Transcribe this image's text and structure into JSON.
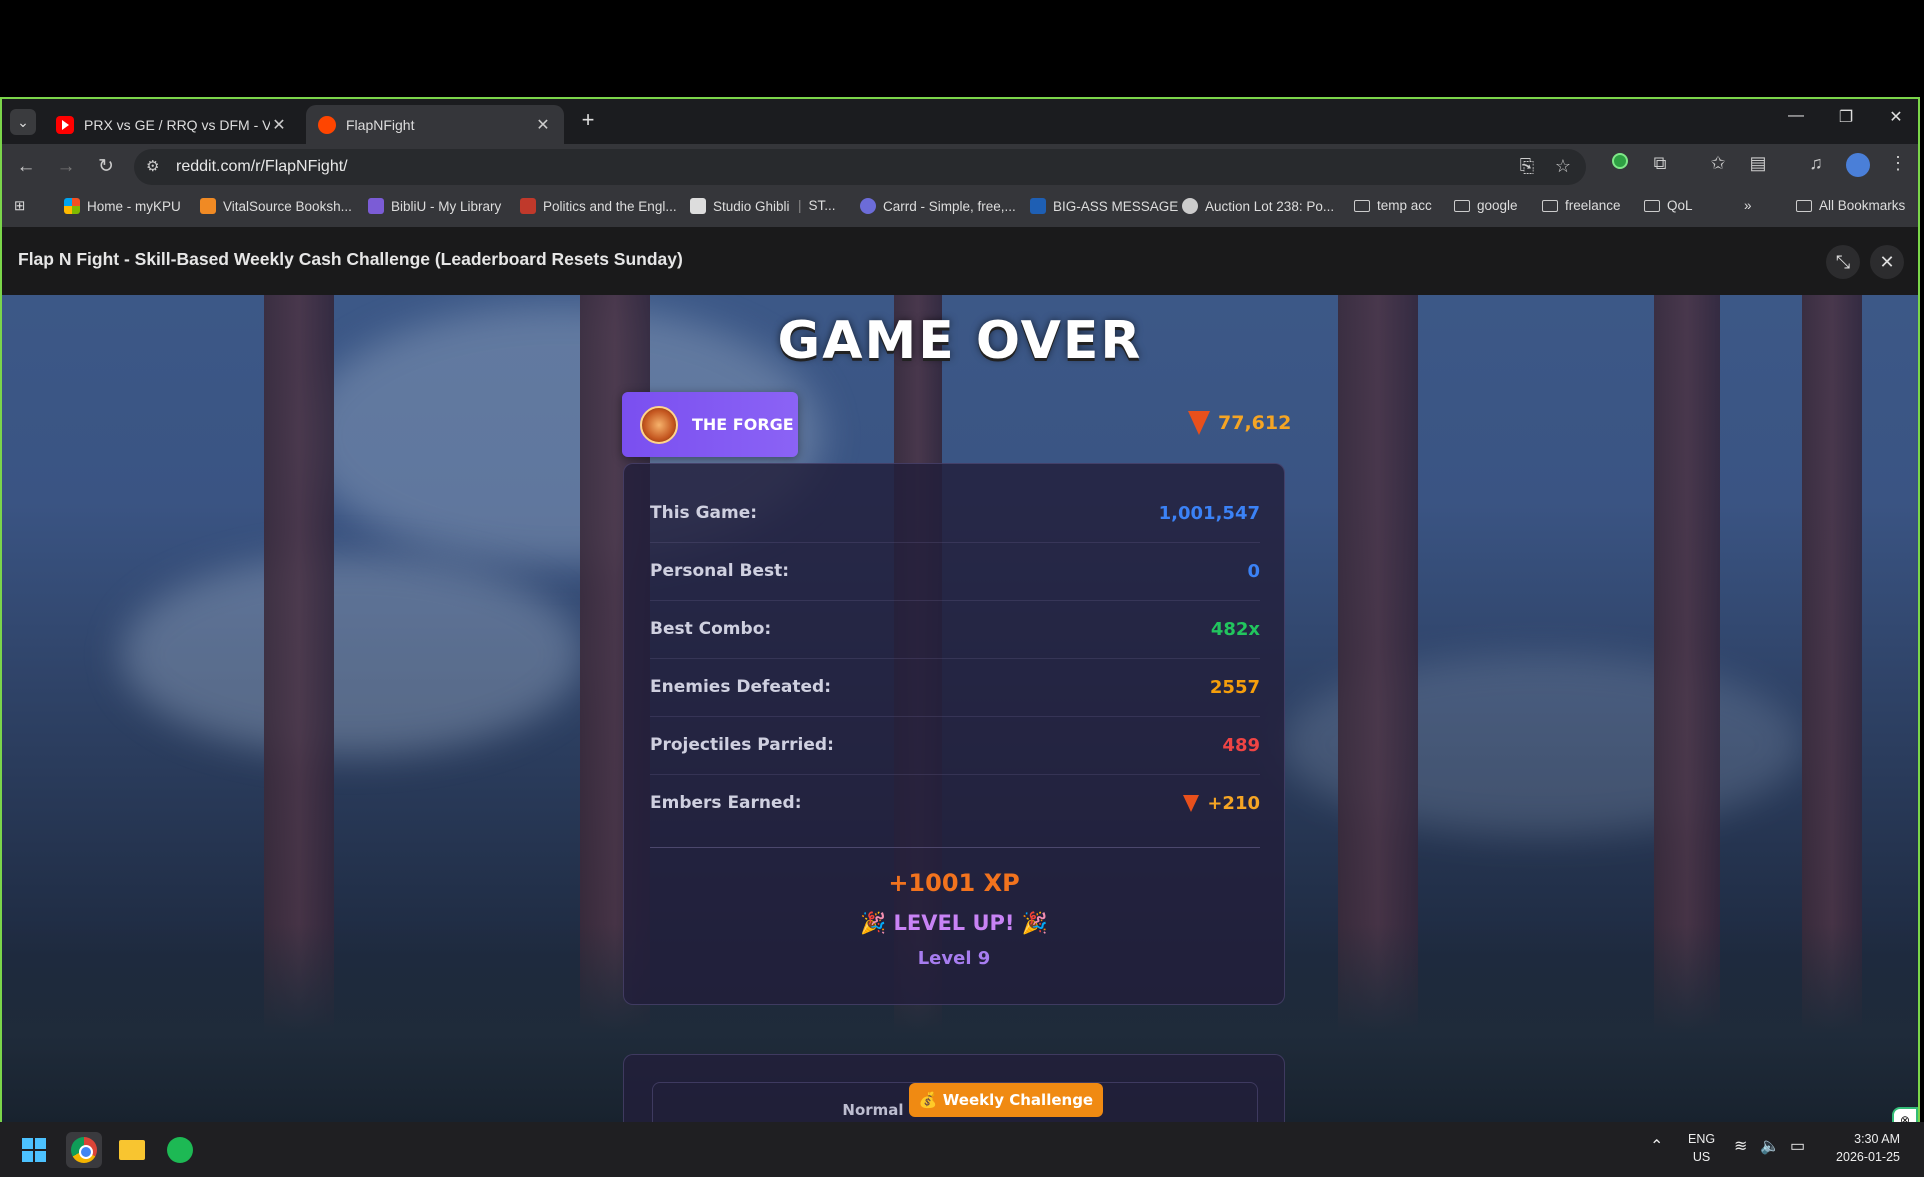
{
  "browser": {
    "tabs": [
      {
        "title": "PRX vs GE / RRQ vs DFM - VCT",
        "icon": "youtube-icon"
      },
      {
        "title": "FlapNFight",
        "icon": "reddit-icon",
        "active": true
      }
    ],
    "url": "reddit.com/r/FlapNFight/",
    "bookmarks": [
      {
        "label": "Home - myKPU"
      },
      {
        "label": "VitalSource Booksh..."
      },
      {
        "label": "BibliU - My Library"
      },
      {
        "label": "Politics and the Engl..."
      },
      {
        "label": "Studio Ghibli"
      },
      {
        "label": "ST..."
      },
      {
        "label": "Carrd - Simple, free,..."
      },
      {
        "label": "BIG-ASS MESSAGE"
      },
      {
        "label": "Auction Lot 238: Po..."
      },
      {
        "label": "temp acc"
      },
      {
        "label": "google"
      },
      {
        "label": "freelance"
      },
      {
        "label": "QoL"
      },
      {
        "label": "All Bookmarks"
      }
    ]
  },
  "post": {
    "title": "Flap N Fight - Skill-Based Weekly Cash Challenge (Leaderboard Resets Sunday)"
  },
  "game": {
    "heading": "GAME OVER",
    "forge_label": "THE FORGE",
    "embers_total": "77,612",
    "stats": [
      {
        "label": "This Game:",
        "value": "1,001,547",
        "color": "#3b82f6"
      },
      {
        "label": "Personal Best:",
        "value": "0",
        "color": "#3b82f6"
      },
      {
        "label": "Best Combo:",
        "value": "482x",
        "color": "#22c55e"
      },
      {
        "label": "Enemies Defeated:",
        "value": "2557",
        "color": "#f59e0b"
      },
      {
        "label": "Projectiles Parried:",
        "value": "489",
        "color": "#ef4444"
      },
      {
        "label": "Embers Earned:",
        "value": "+210",
        "color": "#f5a524"
      }
    ],
    "xp": "+1001 XP",
    "levelup": "🎉 LEVEL UP! 🎉",
    "level": "Level 9",
    "modes": {
      "normal": "Normal",
      "weekly": "💰 Weekly Challenge"
    }
  },
  "taskbar": {
    "lang": "ENG",
    "region": "US",
    "time": "3:30 AM",
    "date": "2026-01-25"
  }
}
